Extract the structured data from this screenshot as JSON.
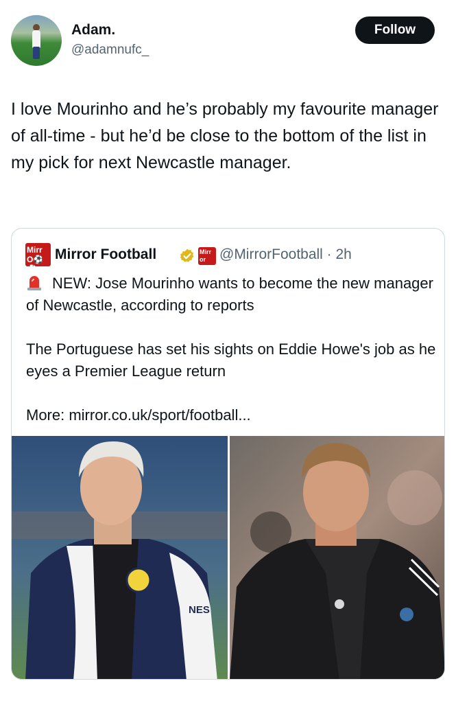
{
  "author": {
    "display_name": "Adam.",
    "handle": "@adamnufc_",
    "avatar_icon": "avatar-footballer-photo"
  },
  "follow_button": {
    "label": "Follow"
  },
  "tweet_text": "I love Mourinho and he’s probably my favourite manager of all-time - but he’d be close to the bottom of the list in my pick for next Newcastle manager.",
  "quote": {
    "logo_text": "Mirror Football logo",
    "display_name": "Mirror Football",
    "verified_icon": "gold-verified-badge-icon",
    "affiliate_badge": "Mirror affiliate badge",
    "handle_time": "@MirrorFootball · 2h",
    "siren_icon": "siren-emoji-icon",
    "paragraph_1": "NEW: Jose Mourinho wants to become the new manager of Newcastle, according to reports",
    "paragraph_2": "The Portuguese has set his sights on Eddie Howe's job as he eyes a Premier League return",
    "paragraph_3": "More: mirror.co.uk/sport/football...",
    "images": [
      {
        "icon": "photo-jose-mourinho"
      },
      {
        "icon": "photo-eddie-howe"
      }
    ]
  },
  "colors": {
    "text": "#0f1419",
    "secondary_text": "#536471",
    "border": "#cfd9de",
    "follow_bg": "#0f1419",
    "mirror_red": "#c41a1a",
    "verified_gold": "#e2b719"
  }
}
